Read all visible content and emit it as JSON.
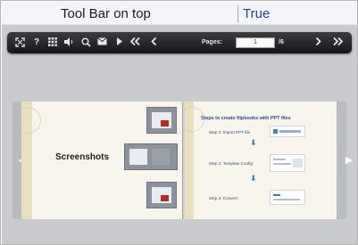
{
  "property": {
    "name": "Tool Bar on top",
    "value": "True"
  },
  "toolbar": {
    "pages_label": "Pages:",
    "current_page": "1",
    "total_pages": "/6",
    "icons": [
      "fit-screen-icon",
      "help-icon",
      "thumbnails-icon",
      "sound-icon",
      "zoom-icon",
      "email-icon",
      "play-icon",
      "first-page-icon",
      "previous-page-icon",
      "next-page-icon",
      "last-page-icon"
    ]
  },
  "book": {
    "left_page_title": "Screenshots",
    "right_page_title": "Steps to create flipbooks with PPT files",
    "steps": [
      "Step 1: Import PPT file",
      "Step 2: Template Config",
      "Step 3: Convert"
    ]
  },
  "colors": {
    "toolbar_bg": "#1f2022",
    "value_text": "#1f3fa8",
    "preview_bg": "#c9cbce"
  }
}
